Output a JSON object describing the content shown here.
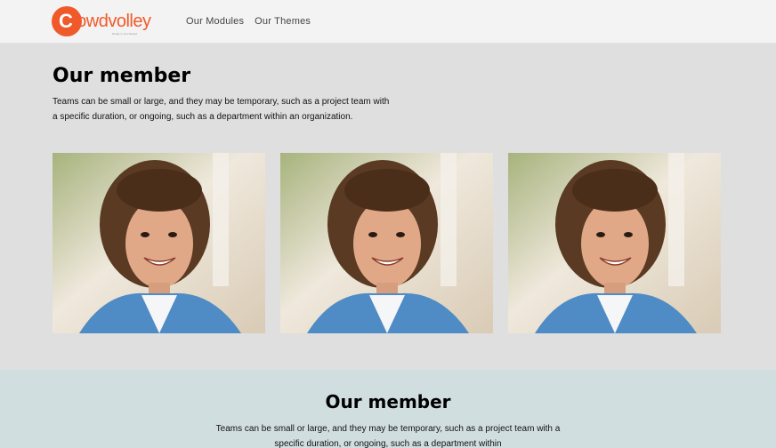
{
  "brand": {
    "logo_letter": "C",
    "logo_text": "rowdvolley",
    "tagline": "Ready to Get Started",
    "accent": "#f05a2a"
  },
  "nav": {
    "items": [
      "Our Modules",
      "Our Themes"
    ]
  },
  "section1": {
    "title": "Our member",
    "description": "Teams can be small or large, and they may be temporary, such as a project team with a specific duration, or ongoing, such as a department within an organization."
  },
  "section2": {
    "title": "Our member",
    "description": "Teams can be small or large, and they may be temporary, such as a project team with a specific duration, or ongoing, such as a department within"
  },
  "members": [
    {
      "photo": "smiling-boy-photo"
    },
    {
      "photo": "smiling-boy-photo"
    },
    {
      "photo": "smiling-boy-photo"
    }
  ]
}
